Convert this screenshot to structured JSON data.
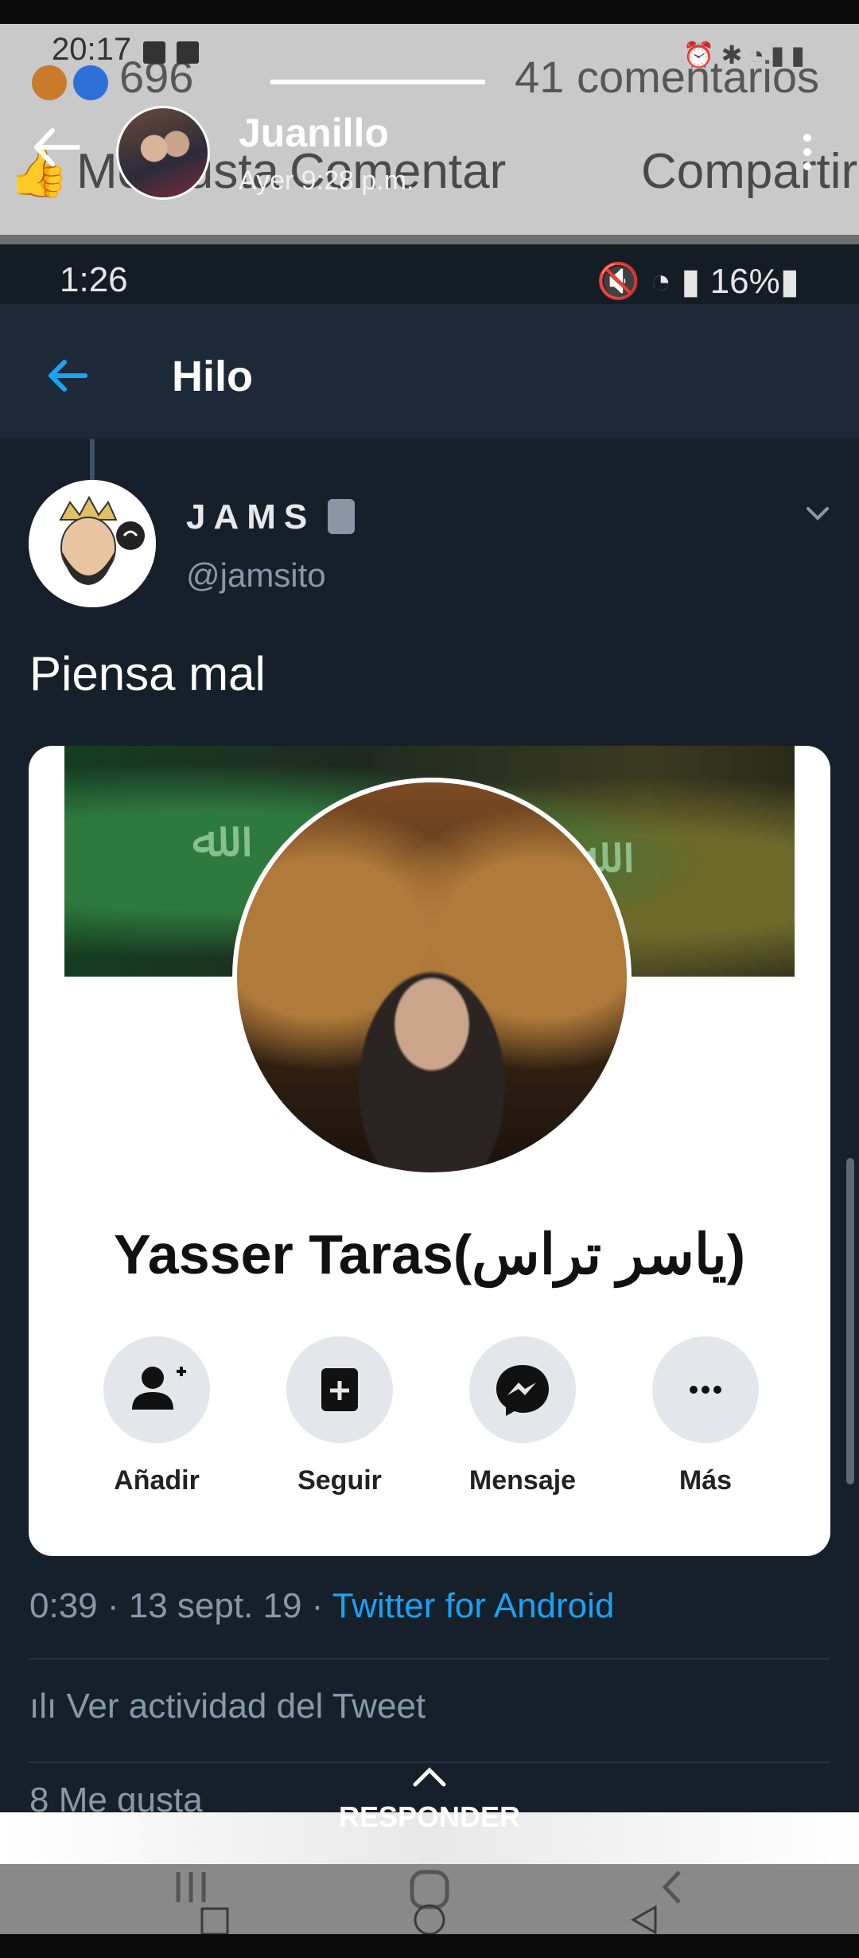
{
  "outer_status": {
    "time": "20:17",
    "icons": [
      "image-icon",
      "s-icon",
      "alarm-icon",
      "bluetooth-icon",
      "wifi-icon",
      "signal-icon",
      "battery-icon"
    ]
  },
  "fb_post": {
    "ghost_comments": "41 comentarios",
    "ghost_count": "696",
    "ghost_actions": [
      "Me gusta",
      "Comentar",
      "Compartir"
    ],
    "author": "Juanillo",
    "time": "Ayer 9:28 p.m."
  },
  "tw_status": {
    "time": "1:26",
    "battery": "16%"
  },
  "tw_header": {
    "title": "Hilo"
  },
  "tweet": {
    "display_name": "JAMS",
    "handle": "@jamsito",
    "text": "Piensa mal",
    "meta_prefix": "0:39 · 13 sept. 19 · ",
    "source": "Twitter for Android",
    "activity": "Ver actividad del Tweet",
    "likes_partial": "8 Me gusta"
  },
  "card": {
    "profile_name": "Yasser Taras(ياسر تراس)",
    "buttons": [
      "Añadir",
      "Seguir",
      "Mensaje",
      "Más"
    ]
  },
  "reply": {
    "label": "RESPONDER"
  },
  "colors": {
    "twitter_bg": "#15202b",
    "twitter_header": "#1c2938",
    "twitter_blue": "#1da1f2",
    "muted": "#8899a6"
  }
}
